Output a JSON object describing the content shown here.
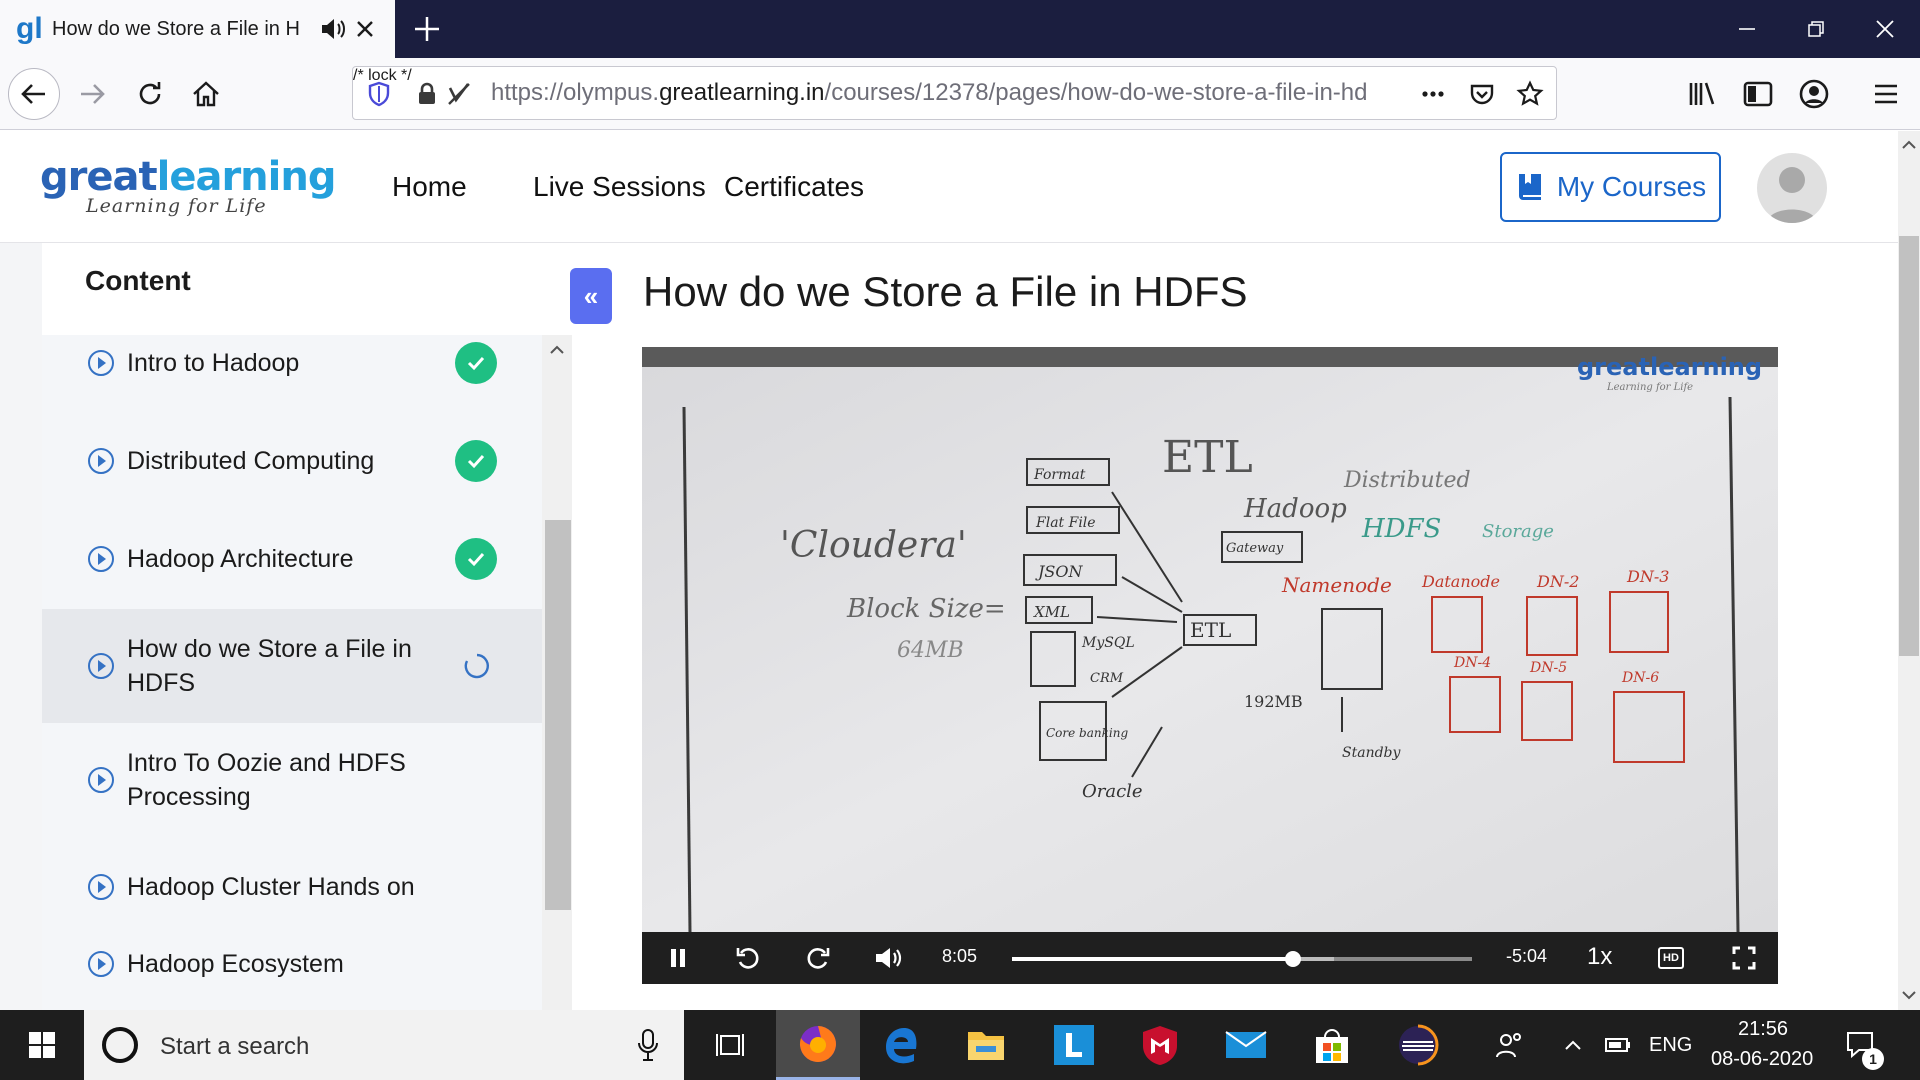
{
  "browser": {
    "tab_title": "How do we Store a File in H",
    "favicon": "gl",
    "url_prefix": "https://olympus.",
    "url_domain": "greatlearning.in",
    "url_path": "/courses/12378/pages/how-do-we-store-a-file-in-hd",
    "icons": [
      "back-icon",
      "forward-icon",
      "reload-icon",
      "home-icon",
      "shield-icon",
      "lock-icon",
      "permissions-icon",
      "more-icon",
      "pocket-icon",
      "bookmark-star-icon",
      "library-icon",
      "sidebar-icon",
      "account-icon",
      "menu-icon"
    ]
  },
  "site": {
    "logo_great": "great",
    "logo_learning": "learning",
    "logo_tagline": "Learning for Life",
    "nav": [
      "Home",
      "Live Sessions",
      "Certificates"
    ],
    "my_courses": "My Courses"
  },
  "sidebar": {
    "title": "Content",
    "items": [
      {
        "label": "Intro to Hadoop",
        "status": "complete"
      },
      {
        "label": "Distributed Computing",
        "status": "complete"
      },
      {
        "label": "Hadoop Architecture",
        "status": "complete"
      },
      {
        "label": "How do we Store a File in HDFS",
        "status": "in-progress"
      },
      {
        "label": "Intro To Oozie and HDFS Processing",
        "status": "none"
      },
      {
        "label": "Hadoop Cluster Hands on",
        "status": "none"
      },
      {
        "label": "Hadoop Ecosystem",
        "status": "none"
      }
    ],
    "collapse_label": "«"
  },
  "main": {
    "title": "How do we Store a File in HDFS",
    "video": {
      "watermark": "greatlearning",
      "watermark_tag": "Learning for Life",
      "elapsed": "8:05",
      "remaining": "-5:04",
      "speed": "1x",
      "quality": "HD",
      "progress": 0.61,
      "buffered": 0.7
    }
  },
  "taskbar": {
    "search_placeholder": "Start a search",
    "language": "ENG",
    "time": "21:56",
    "date": "08-06-2020",
    "notification_count": "1"
  },
  "colors": {
    "accent_blue": "#1b66c9",
    "check_green": "#1fbf83",
    "collapse_purple": "#5a6ef0",
    "titlebar": "#1b1e3f"
  }
}
